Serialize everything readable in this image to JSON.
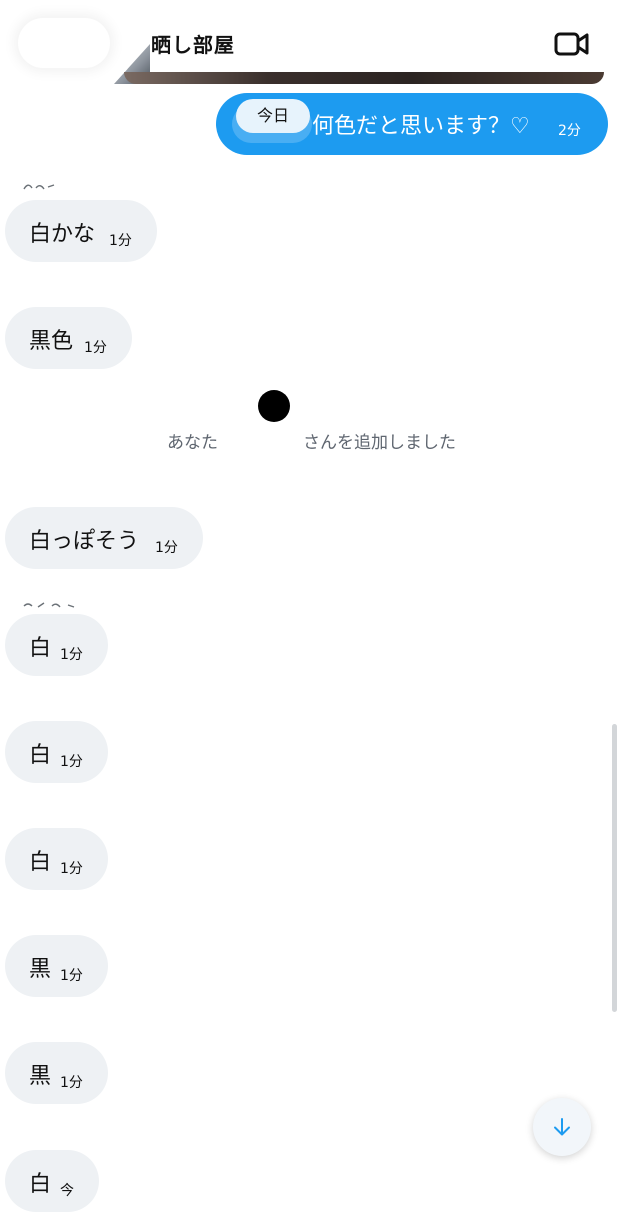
{
  "header": {
    "title": "晒し部屋",
    "video_icon": "video-camera-icon"
  },
  "outgoing": {
    "text": "何色だと思います？♡",
    "time": "2分"
  },
  "day_divider": "今日",
  "system_notice": {
    "text": "あなた　　　　　さんを追加しました"
  },
  "messages": [
    {
      "text": "白かな",
      "time": "1分"
    },
    {
      "text": "黒色",
      "time": "1分"
    },
    {
      "text": "白っぽそう",
      "time": "1分"
    },
    {
      "text": "白",
      "time": "1分"
    },
    {
      "text": "白",
      "time": "1分"
    },
    {
      "text": "白",
      "time": "1分"
    },
    {
      "text": "黒",
      "time": "1分"
    },
    {
      "text": "黒",
      "time": "1分"
    },
    {
      "text": "白",
      "time": "今"
    }
  ],
  "scroll_down_icon": "arrow-down-icon",
  "colors": {
    "accent": "#1d9bf0",
    "incoming_bubble": "#eef1f4"
  }
}
